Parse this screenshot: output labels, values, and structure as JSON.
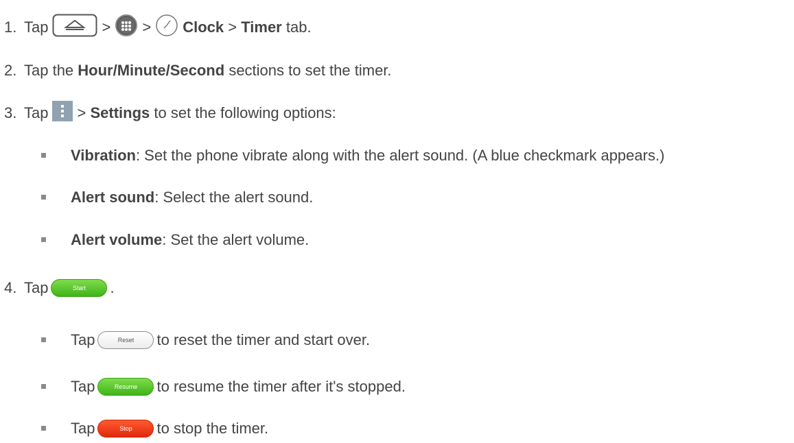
{
  "steps": [
    {
      "number": "1.",
      "prefix": "Tap",
      "sep1": ">",
      "sep2": ">",
      "clock": "Clock",
      "sep3": ">",
      "timer": "Timer",
      "suffix": "tab."
    },
    {
      "number": "2.",
      "prefix": "Tap the",
      "bold": "Hour/Minute/Second",
      "suffix": "sections to set the timer."
    },
    {
      "number": "3.",
      "prefix": "Tap",
      "sep": ">",
      "bold": "Settings",
      "suffix": "to set the following options:"
    },
    {
      "number": "4.",
      "prefix": "Tap",
      "suffix": "."
    }
  ],
  "settings_options": [
    {
      "bold": "Vibration",
      "text": ": Set the phone vibrate along with the alert sound. (A blue checkmark appears.)"
    },
    {
      "bold": "Alert sound",
      "text": ": Select the alert sound."
    },
    {
      "bold": "Alert volume",
      "text": ": Set the alert volume."
    }
  ],
  "buttons": {
    "start": "Start",
    "reset": "Reset",
    "resume": "Resume",
    "stop": "Stop"
  },
  "timer_actions": [
    {
      "prefix": "Tap",
      "text": "to reset the timer and start over."
    },
    {
      "prefix": "Tap",
      "text": "to resume the timer after it's stopped."
    },
    {
      "prefix": "Tap",
      "text": "to stop the timer."
    }
  ],
  "icons": [
    "home-key-icon",
    "apps-icon",
    "clock-icon",
    "menu-icon"
  ],
  "colors": {
    "start_green": "#4cbf22",
    "stop_red": "#ee3511",
    "menu_gray": "#8fa3b1"
  }
}
